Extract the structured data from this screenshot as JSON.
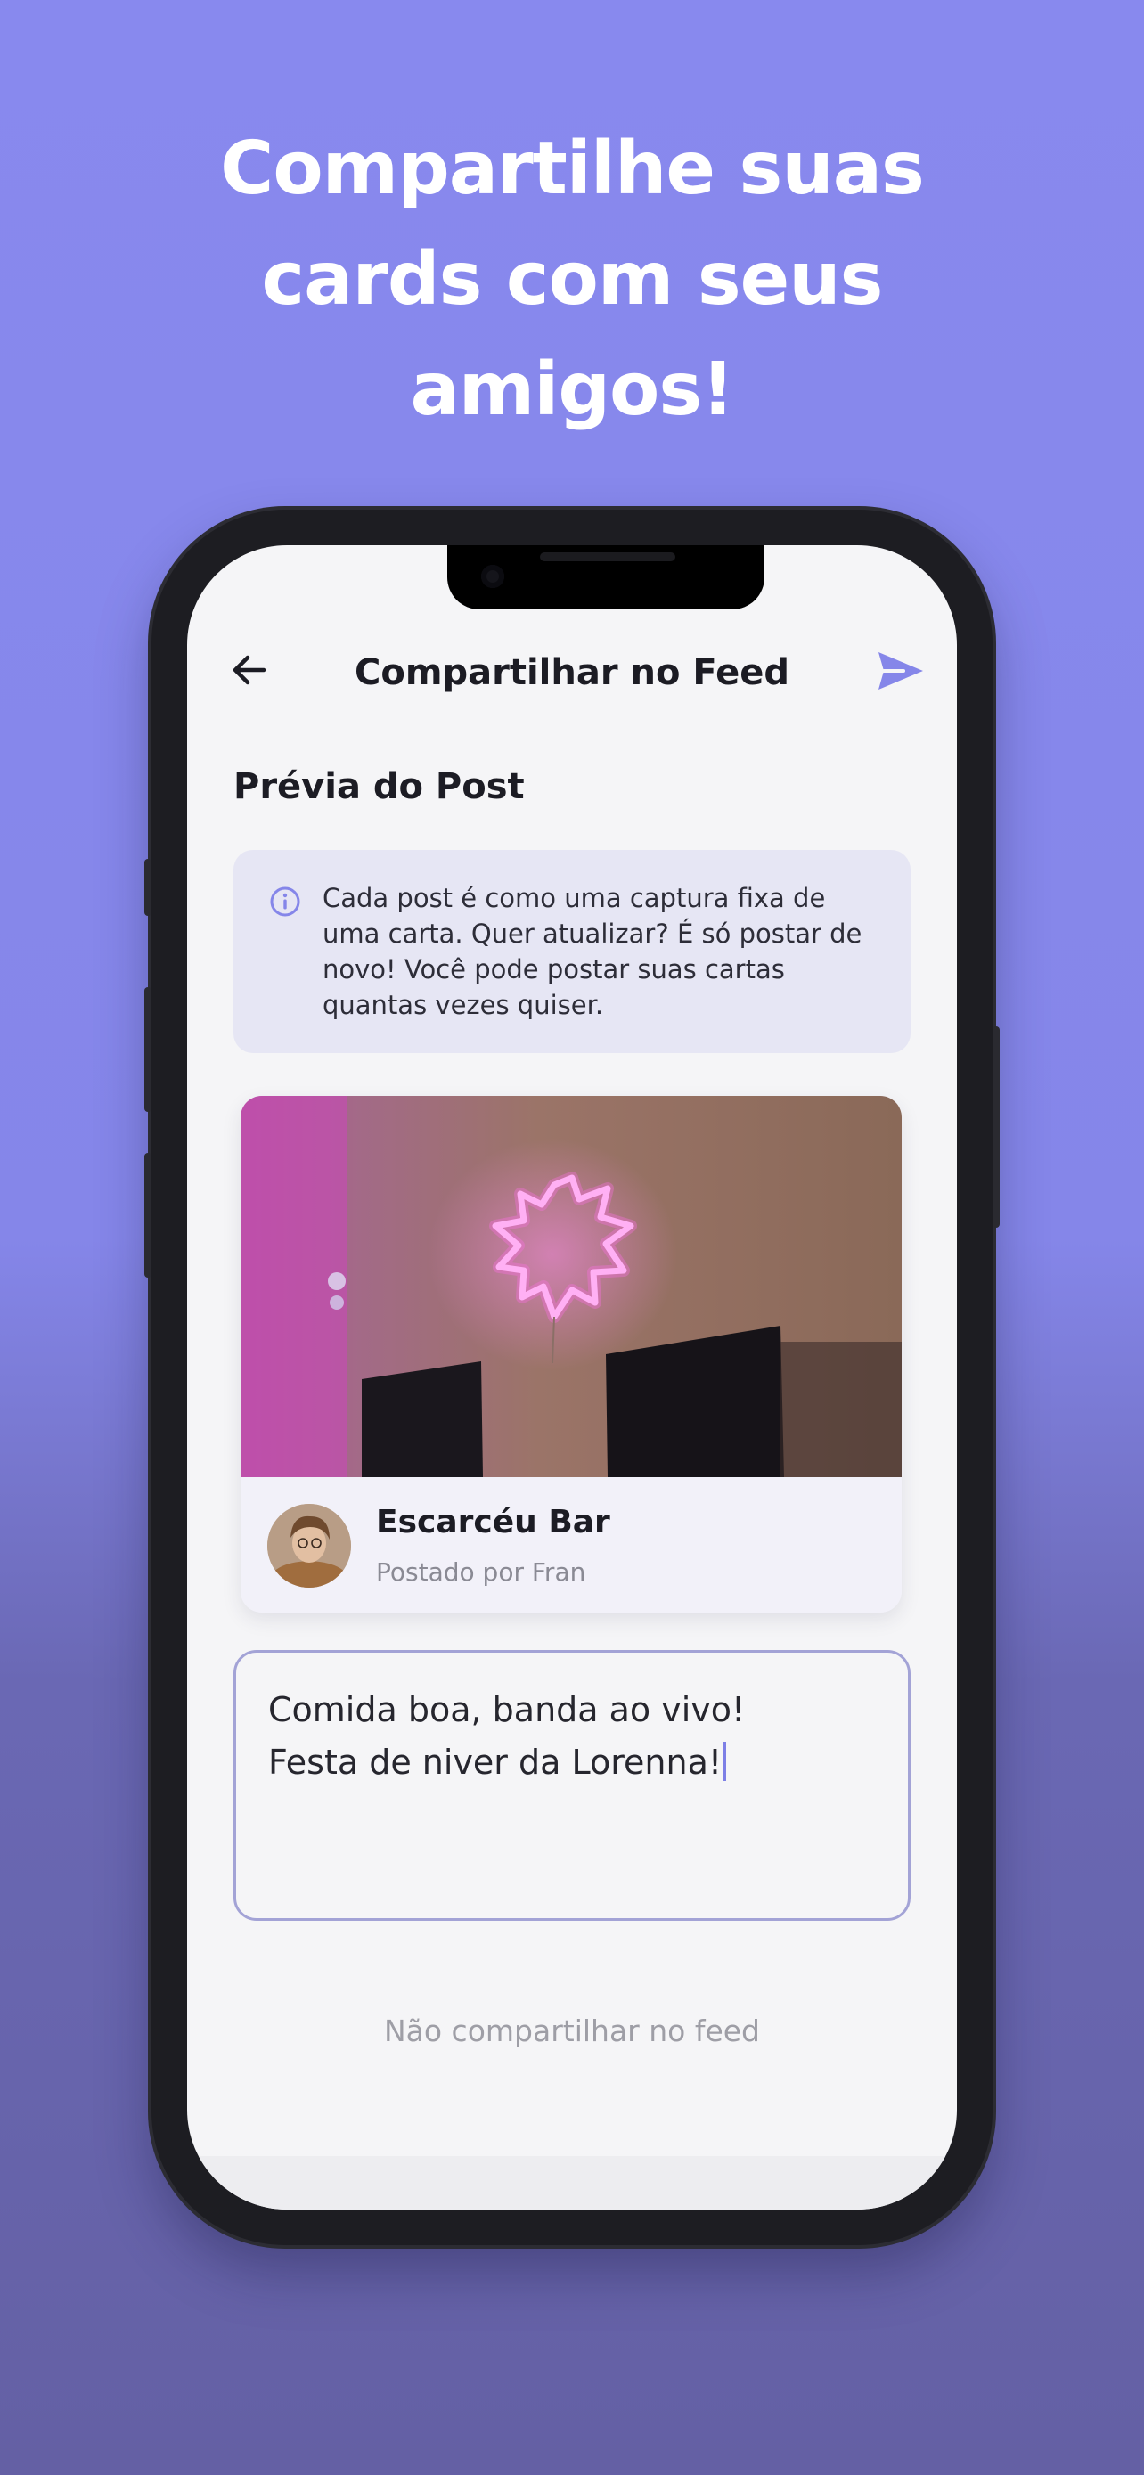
{
  "headline": {
    "line1": "Compartilhe suas",
    "line2": "cards com seus",
    "line3": "amigos!"
  },
  "topbar": {
    "title": "Compartilhar no Feed"
  },
  "preview": {
    "title": "Prévia do Post"
  },
  "info": {
    "text": "Cada post é como uma captura fixa de uma carta. Quer atualizar? É só postar de novo! Você pode postar suas cartas quantas vezes quiser."
  },
  "card": {
    "name": "Escarcéu Bar",
    "author": "Postado por Fran"
  },
  "caption": {
    "line1": "Comida boa, banda ao vivo!",
    "line2": "Festa de niver da Lorenna!"
  },
  "skip_label": "Não compartilhar no feed",
  "colors": {
    "accent": "#8586e9",
    "background_top": "#8889ee",
    "background_bottom": "#6460a4"
  }
}
